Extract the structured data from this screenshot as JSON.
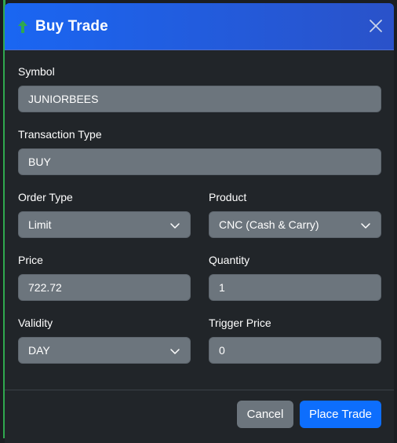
{
  "modal": {
    "title": "Buy Trade",
    "close_icon": "close-icon",
    "title_icon": "arrow-up-icon",
    "accent_color": "#1a66f2"
  },
  "form": {
    "symbol": {
      "label": "Symbol",
      "value": "JUNIORBEES"
    },
    "transaction_type": {
      "label": "Transaction Type",
      "value": "BUY"
    },
    "order_type": {
      "label": "Order Type",
      "value": "Limit"
    },
    "product": {
      "label": "Product",
      "value": "CNC (Cash & Carry)"
    },
    "price": {
      "label": "Price",
      "value": "722.72"
    },
    "quantity": {
      "label": "Quantity",
      "value": "1"
    },
    "validity": {
      "label": "Validity",
      "value": "DAY"
    },
    "trigger_price": {
      "label": "Trigger Price",
      "value": "0"
    }
  },
  "footer": {
    "cancel_label": "Cancel",
    "place_label": "Place Trade"
  }
}
